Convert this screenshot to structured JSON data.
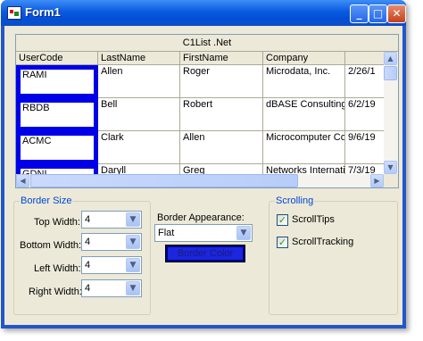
{
  "window": {
    "title": "Form1"
  },
  "title_buttons": {
    "minimize": "_",
    "maximize": "□",
    "close": "✕"
  },
  "grid": {
    "caption": "C1List .Net",
    "columns": [
      "UserCode",
      "LastName",
      "FirstName",
      "Company",
      ""
    ],
    "rows": [
      [
        "RAMI",
        "Allen",
        "Roger",
        "Microdata, Inc.",
        "2/26/1"
      ],
      [
        "RBDB",
        "Bell",
        "Robert",
        "dBASE Consulting",
        "6/2/19"
      ],
      [
        "ACMC",
        "Clark",
        "Allen",
        "Microcomputer Co",
        "9/6/19"
      ],
      [
        "GDNI",
        "Daryll",
        "Greg",
        "Networks Internati",
        "7/3/19"
      ]
    ],
    "selection_color": "#0000e8"
  },
  "border_size": {
    "legend": "Border Size",
    "fields": [
      {
        "label": "Top Width:",
        "value": "4"
      },
      {
        "label": "Bottom Width:",
        "value": "4"
      },
      {
        "label": "Left Width:",
        "value": "4"
      },
      {
        "label": "Right Width:",
        "value": "4"
      }
    ]
  },
  "border_appearance": {
    "label": "Border Appearance:",
    "value": "Flat",
    "color_button": "Border Color",
    "color_button_bg": "#1a26e0"
  },
  "scrolling": {
    "legend": "Scrolling",
    "options": [
      {
        "label": "ScrollTips",
        "checked": true
      },
      {
        "label": "ScrollTracking",
        "checked": true
      }
    ]
  },
  "icons": {
    "scroll_up": "▲",
    "scroll_down": "▼",
    "scroll_left": "◀",
    "scroll_right": "▶",
    "dropdown": "▼",
    "check": "✓"
  },
  "theme": {
    "titlebar": "#0a5ae0",
    "client_bg": "#ece9d8",
    "group_legend": "#0046d5"
  }
}
